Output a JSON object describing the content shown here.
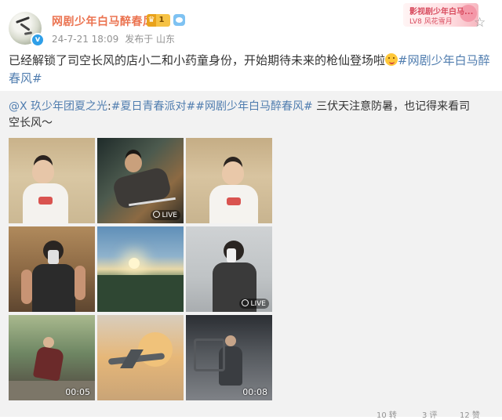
{
  "post": {
    "author": {
      "name": "网剧少年白马醉春风",
      "vip_level": "1",
      "verified_icon": "v"
    },
    "meta": {
      "time": "24-7-21 18:09",
      "location": "发布于 山东"
    },
    "fan_card": {
      "line1": "影视剧少年白马...",
      "line2": "LV8 风花雪月"
    },
    "text_before": "已经解锁了司空长风的店小二和小药童身份，开始期待未来的枪仙登场啦",
    "topic": "#网剧少年白马醉春风#",
    "emoji": "smirk-face"
  },
  "repost": {
    "mention": "@X 玖少年团夏之光",
    "topic1": "#夏日青春派对#",
    "topic2": "#网剧少年白马醉春风#",
    "text": " 三伏天注意防暑，也记得来看司空长风～",
    "media": [
      {
        "kind": "photo",
        "badge": ""
      },
      {
        "kind": "photo",
        "badge": "LIVE"
      },
      {
        "kind": "photo",
        "badge": ""
      },
      {
        "kind": "photo",
        "badge": ""
      },
      {
        "kind": "photo",
        "badge": ""
      },
      {
        "kind": "photo",
        "badge": "LIVE"
      },
      {
        "kind": "video",
        "badge": "00:05"
      },
      {
        "kind": "photo",
        "badge": ""
      },
      {
        "kind": "video",
        "badge": "00:08"
      }
    ]
  },
  "footer": {
    "reposts": "10 转",
    "comments": "3 评",
    "likes": "12 赞"
  },
  "colors": {
    "name": "#eb7350",
    "link": "#507daf",
    "meta": "#939393",
    "repost_bg": "#f2f2f2"
  }
}
